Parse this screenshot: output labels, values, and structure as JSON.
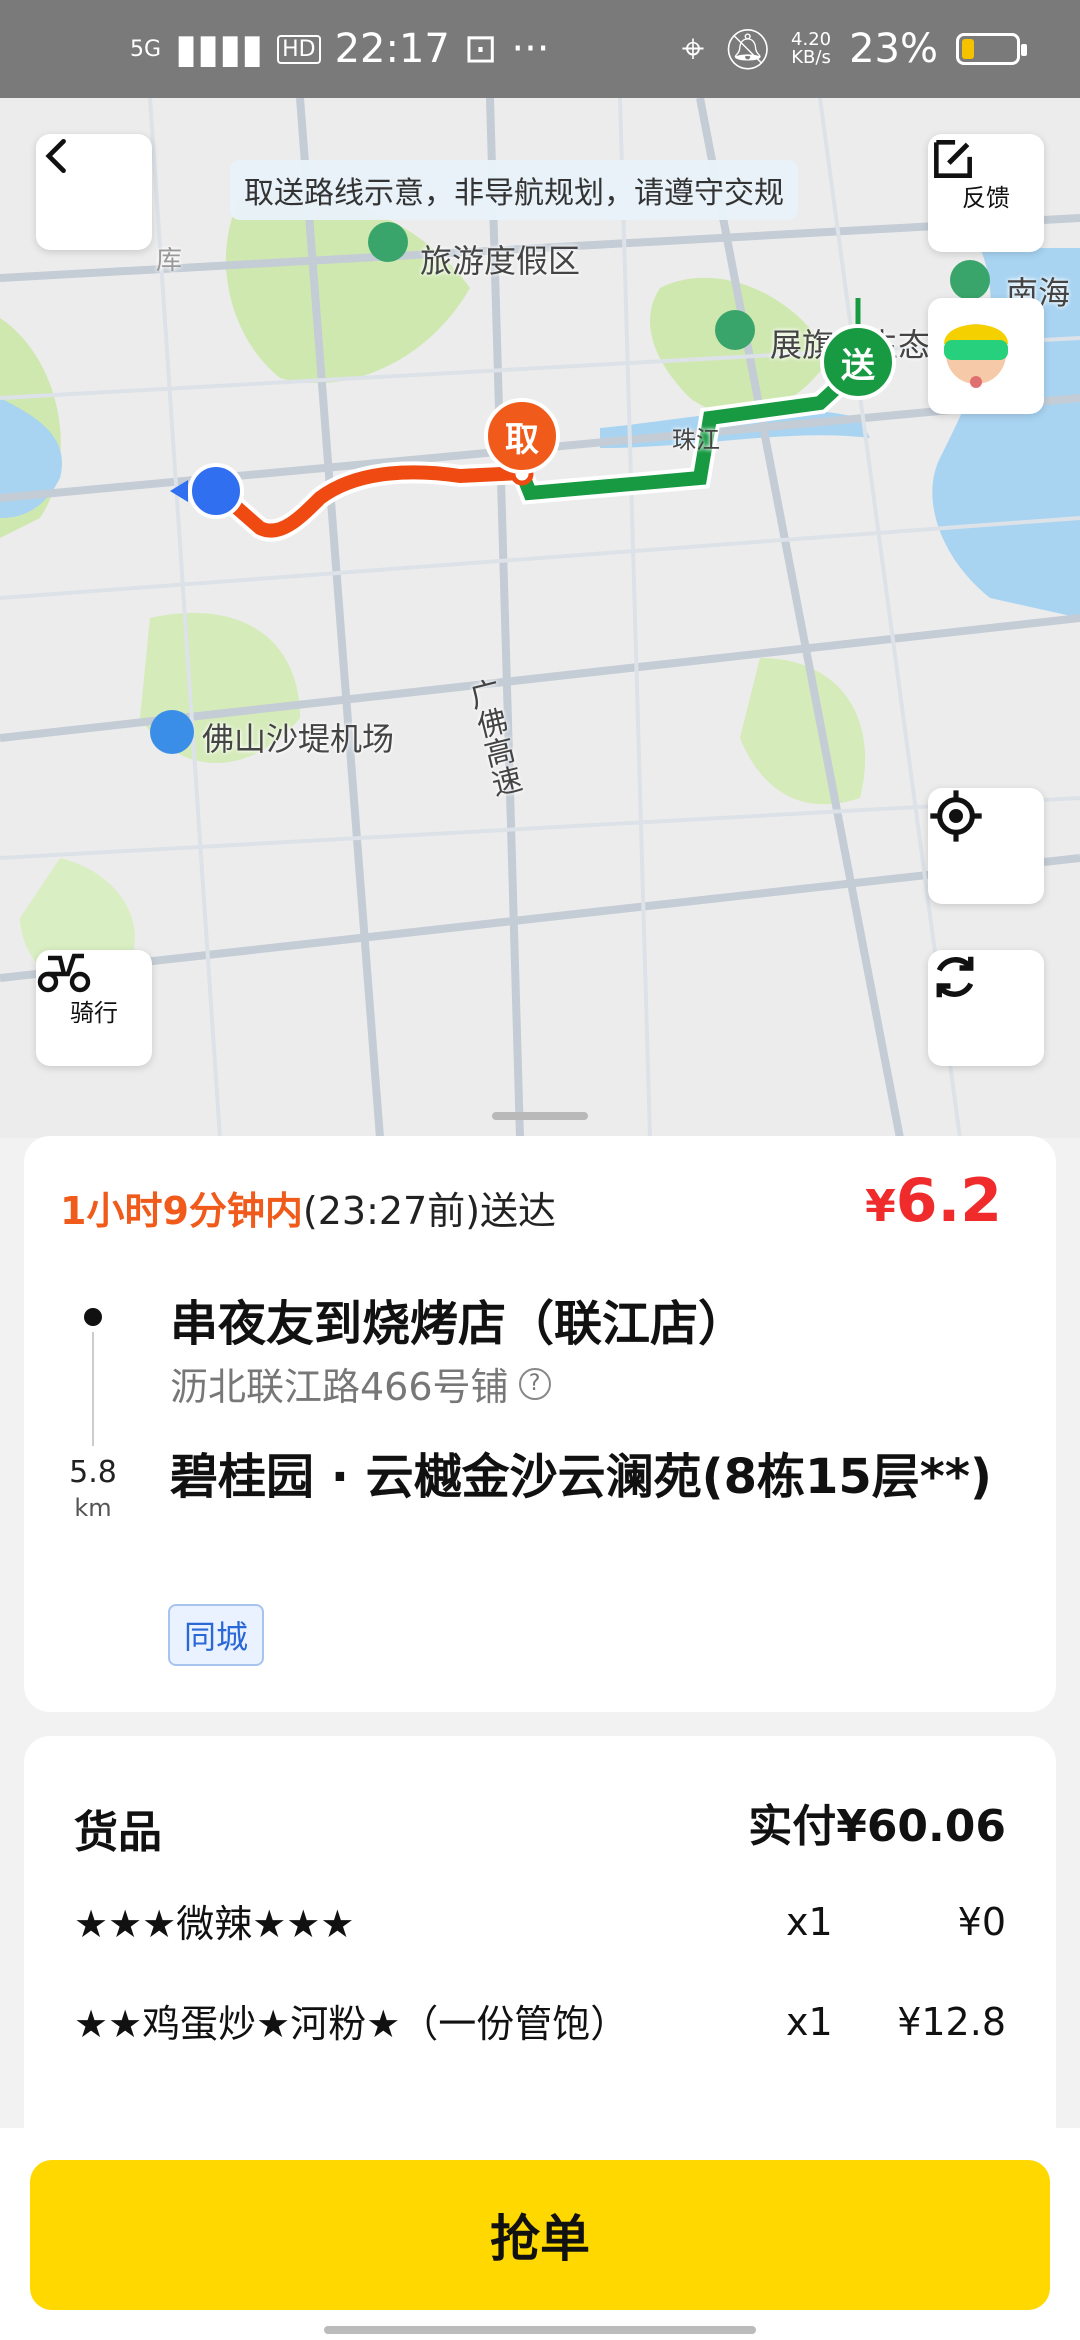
{
  "status_bar": {
    "network": "5G",
    "hd": "HD",
    "time": "22:17",
    "more": "···",
    "speed": "4.20\nKB/s",
    "battery_percent": "23%",
    "battery_level": 0.23
  },
  "map": {
    "notice": "取送路线示意，非导航规划，请遵守交规",
    "feedback_label": "反馈",
    "ride_label": "骑行",
    "labels": {
      "resort": "旅游度假区",
      "park": "展旗峰生态公园",
      "nanhai": "南海",
      "airport": "佛山沙堤机场",
      "highway": "广佛高速",
      "river": "珠江",
      "ku": "库"
    },
    "pickup_pin": "取",
    "deliver_pin": "送"
  },
  "order": {
    "eta_highlight": "1小时9分钟内",
    "eta_rest": "(23:27前)送达",
    "fee_symbol": "¥",
    "fee_value": "6.2",
    "shop_name": "串夜友到烧烤店（联江店）",
    "shop_address": "沥北联江路466号铺",
    "distance_value": "5.8",
    "distance_unit": "km",
    "destination": "碧桂园 · 云樾金沙云澜苑(8栋15层**)",
    "tag": "同城"
  },
  "goods": {
    "title": "货品",
    "total": "实付¥60.06",
    "items": [
      {
        "name": "★★★微辣★★★",
        "qty": "x1",
        "price": "¥0"
      },
      {
        "name": "★★鸡蛋炒★河粉★（一份管饱）",
        "qty": "x1",
        "price": "¥12.8"
      }
    ]
  },
  "action": {
    "grab_label": "抢单"
  },
  "colors": {
    "accent_yellow": "#ffd800",
    "price_red": "#ef2b2b",
    "pickup_orange": "#f05a1a",
    "deliver_green": "#1a9a43",
    "tag_blue": "#2a68d8"
  }
}
